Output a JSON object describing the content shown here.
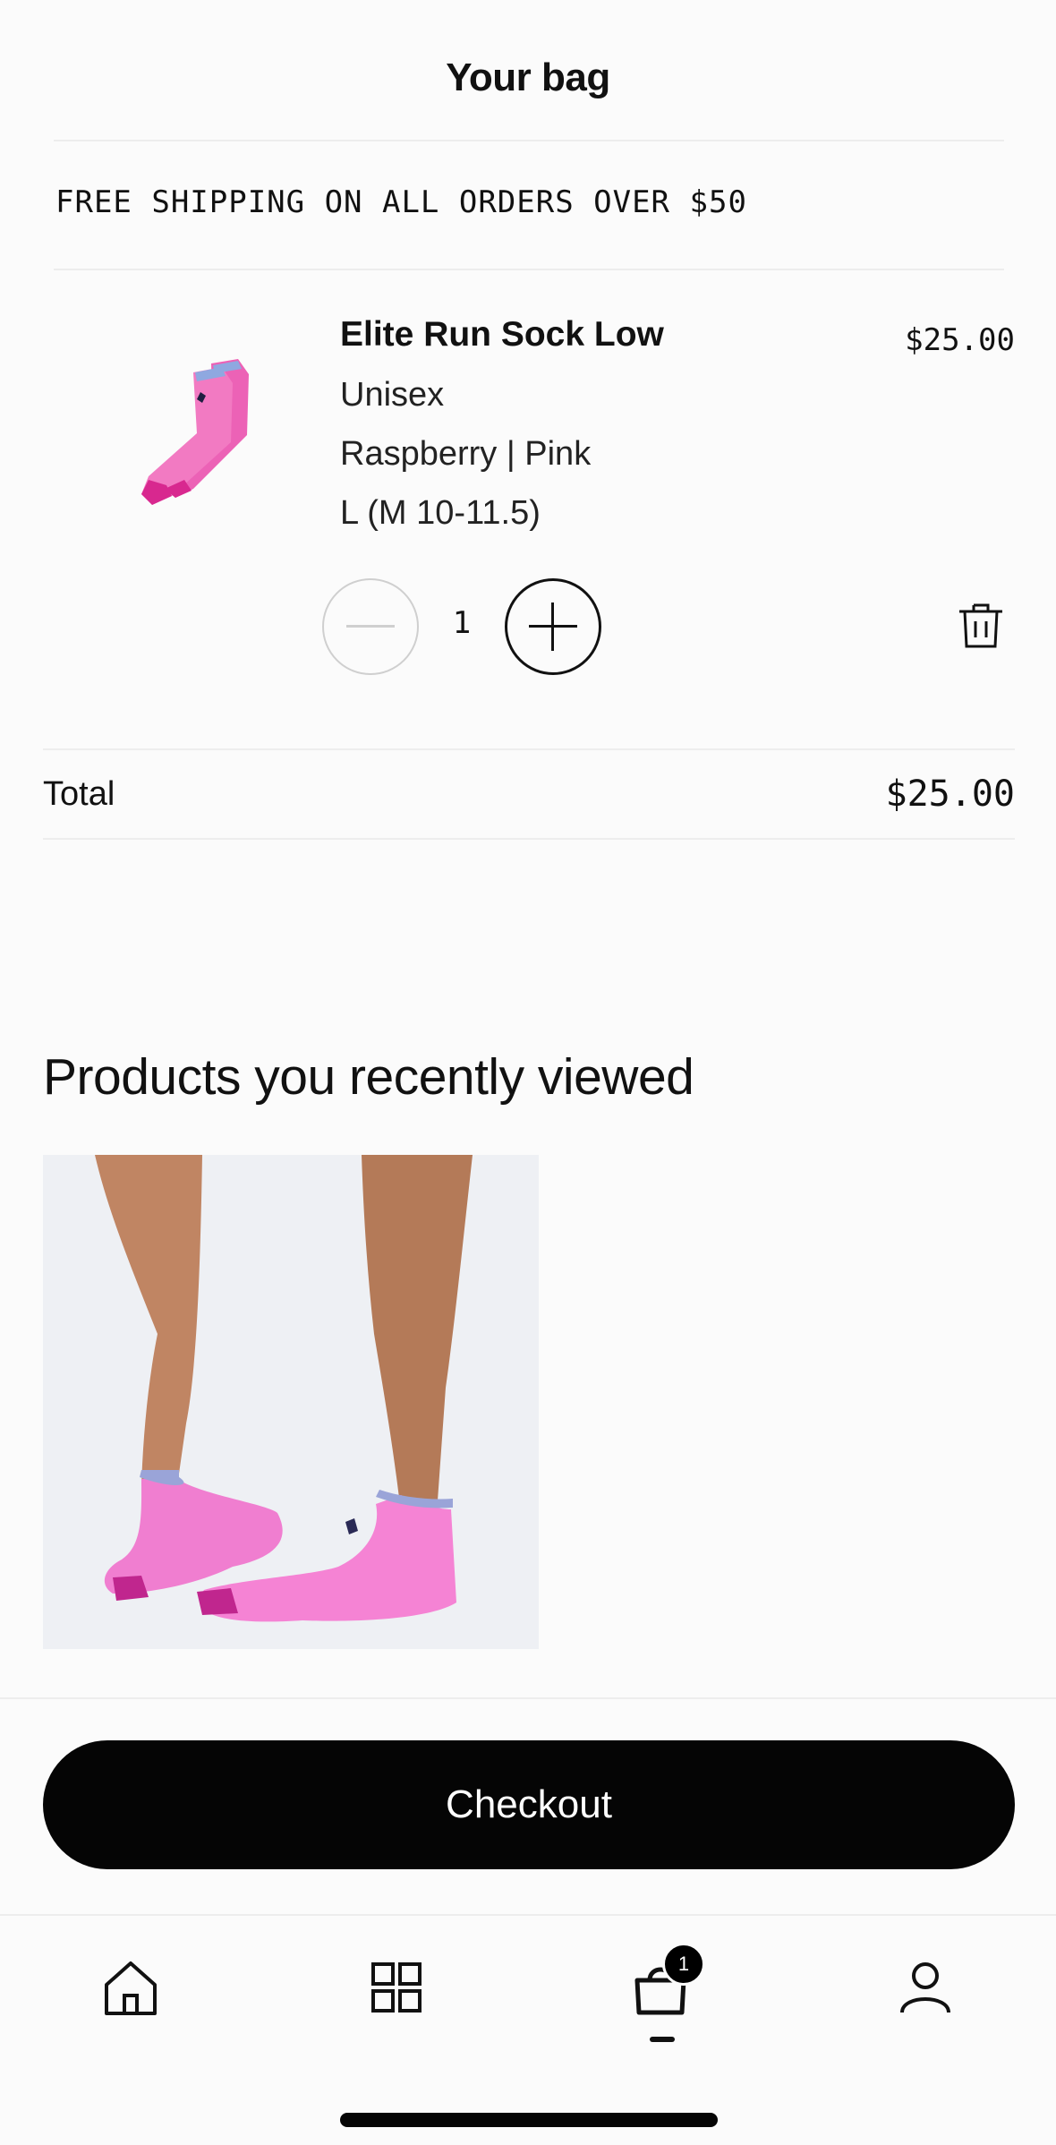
{
  "header": {
    "title": "Your bag"
  },
  "banner": {
    "text": "FREE SHIPPING ON ALL ORDERS OVER $50"
  },
  "cart_item": {
    "name": "Elite Run Sock Low",
    "price": "$25.00",
    "gender": "Unisex",
    "color": "Raspberry | Pink",
    "size": "L (M 10-11.5)",
    "quantity": "1",
    "minus_icon": "minus-icon",
    "plus_icon": "plus-icon",
    "remove_icon": "trash-icon",
    "sock_color": "#f27ac2",
    "sock_accent": "#d8288f"
  },
  "summary": {
    "total_label": "Total",
    "total_value": "$25.00"
  },
  "recently_viewed": {
    "heading": "Products you recently viewed"
  },
  "checkout": {
    "label": "Checkout"
  },
  "tabbar": {
    "items": [
      {
        "icon": "home-icon"
      },
      {
        "icon": "grid-icon"
      },
      {
        "icon": "bag-icon",
        "badge": "1",
        "active": true
      },
      {
        "icon": "user-icon"
      }
    ]
  }
}
